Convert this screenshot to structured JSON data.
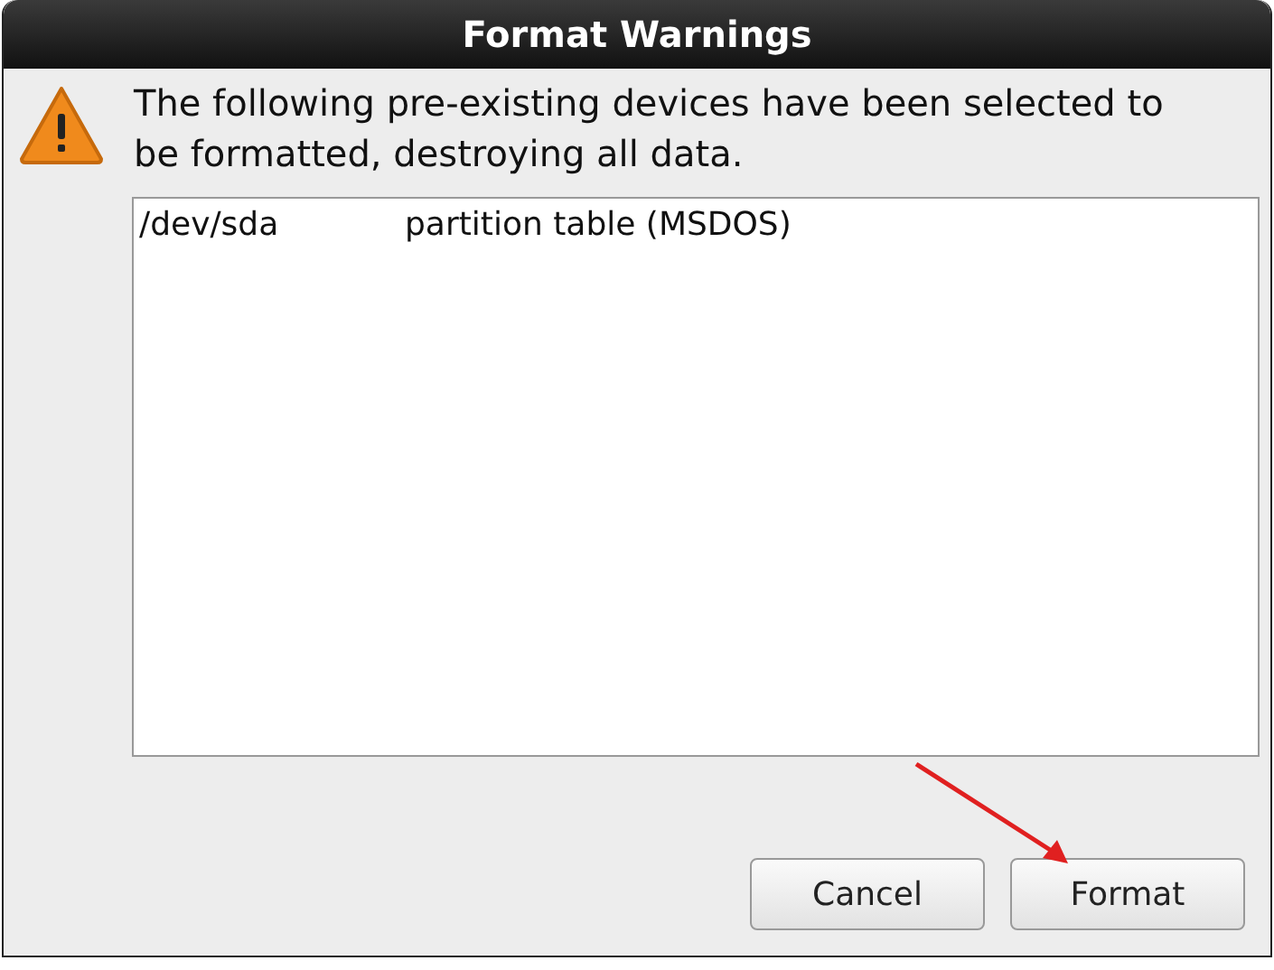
{
  "window": {
    "title": "Format Warnings"
  },
  "message": "The following pre-existing devices have been selected to be formatted, destroying all data.",
  "devices": [
    {
      "device": "/dev/sda",
      "description": "partition table (MSDOS)"
    }
  ],
  "buttons": [
    {
      "label": "Cancel"
    },
    {
      "label": "Format"
    }
  ]
}
